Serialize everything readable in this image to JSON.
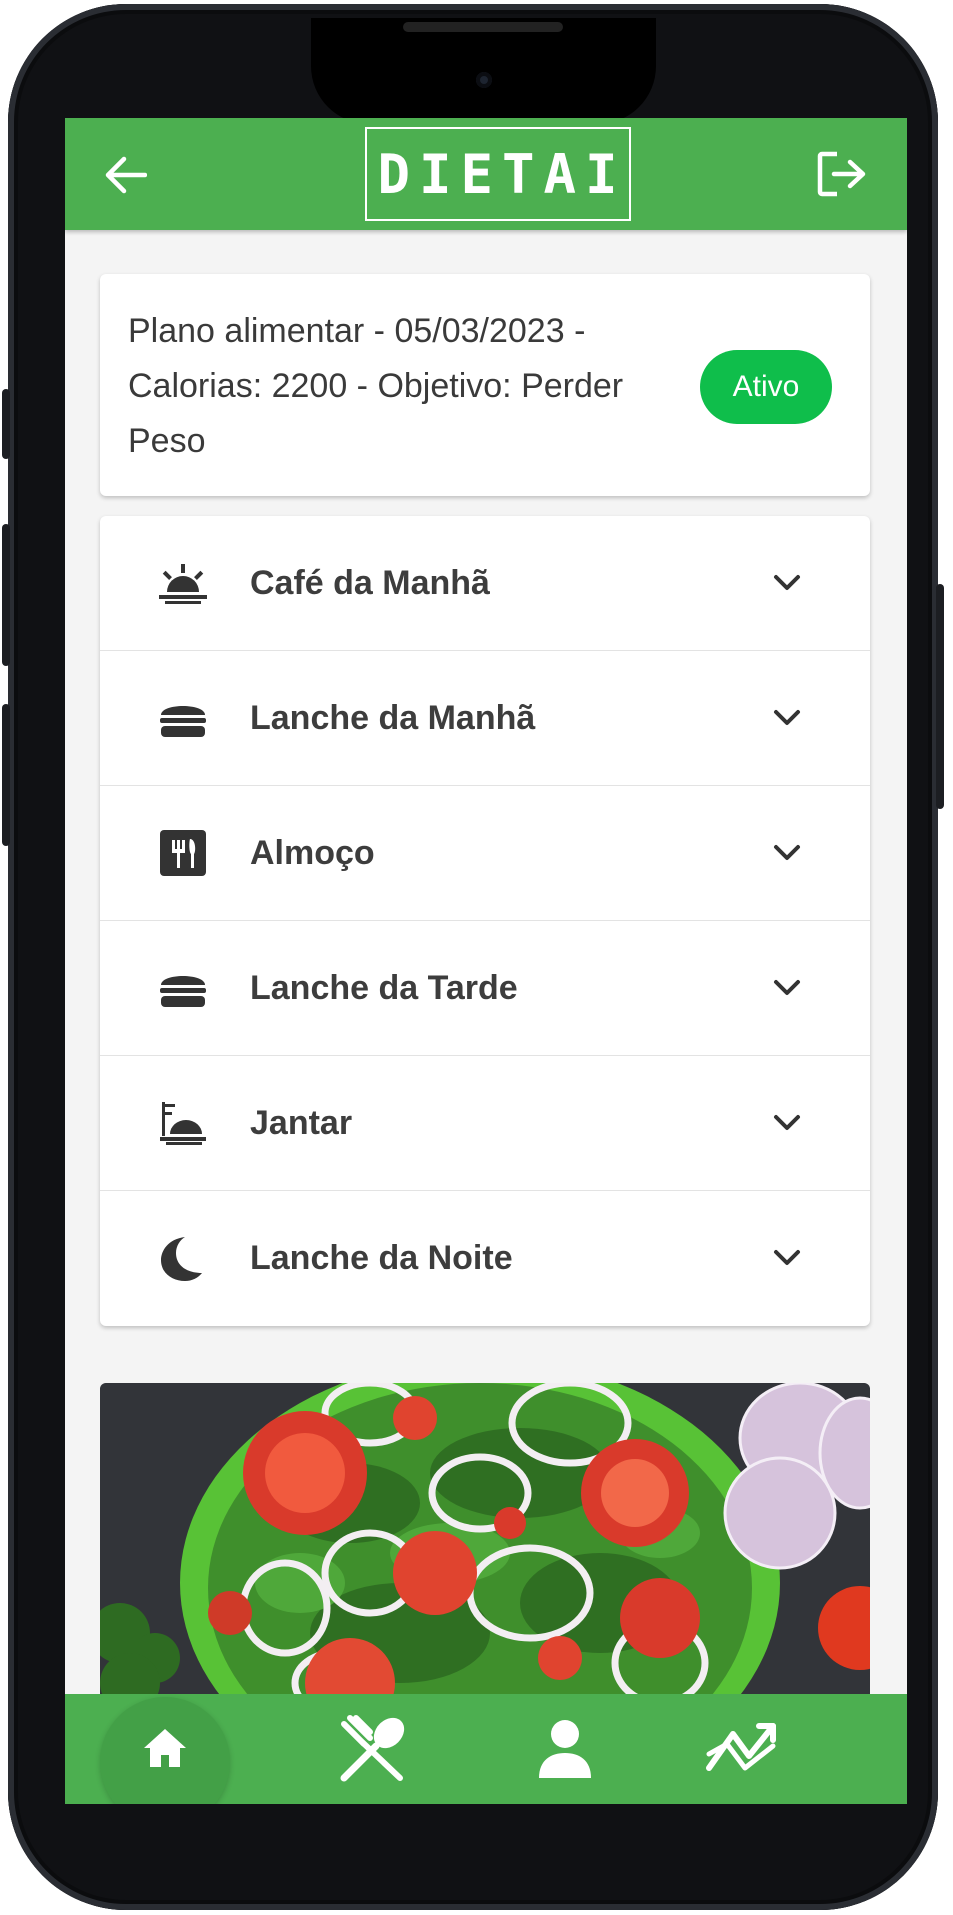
{
  "app": {
    "logo_text": "DIETAI",
    "back_icon": "arrow-left-icon",
    "logout_icon": "logout-icon"
  },
  "plan": {
    "description": "Plano alimentar - 05/03/2023 - Calorias: 2200 - Objetivo: Perder Peso",
    "status": "Ativo"
  },
  "meals": [
    {
      "label": "Café da Manhã",
      "icon": "sunrise-icon"
    },
    {
      "label": "Lanche da Manhã",
      "icon": "burger-icon"
    },
    {
      "label": "Almoço",
      "icon": "utensils-icon"
    },
    {
      "label": "Lanche da Tarde",
      "icon": "burger-icon"
    },
    {
      "label": "Jantar",
      "icon": "dinner-plate-icon"
    },
    {
      "label": "Lanche da Noite",
      "icon": "moon-icon"
    }
  ],
  "bottom_nav": [
    {
      "icon": "home-icon",
      "active": true
    },
    {
      "icon": "fork-spoon-icon",
      "active": false
    },
    {
      "icon": "user-icon",
      "active": false
    },
    {
      "icon": "trend-chart-icon",
      "active": false
    }
  ],
  "colors": {
    "primary": "#4caf50",
    "badge": "#0fbe4b",
    "background": "#f4f4f4",
    "text": "#3d3d3d"
  }
}
